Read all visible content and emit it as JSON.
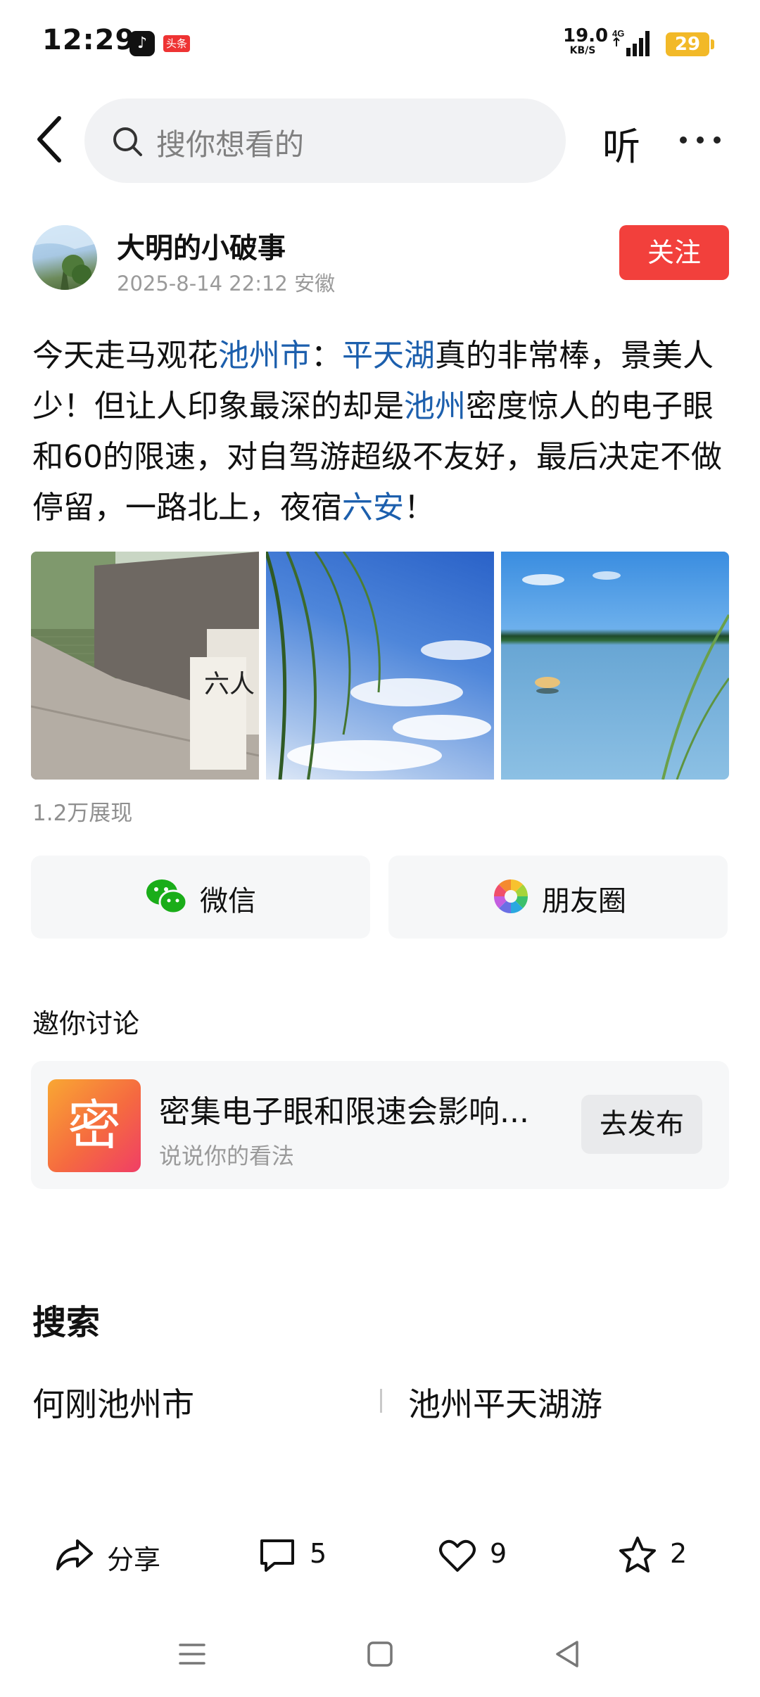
{
  "status_bar": {
    "time": "12:29",
    "app_badge_1": "♪",
    "app_badge_2": "头条",
    "net_speed": "19.0",
    "net_unit": "KB/S",
    "network_type": "4G",
    "battery": "29"
  },
  "nav": {
    "search_placeholder": "搜你想看的",
    "listen_label": "听"
  },
  "author": {
    "name": "大明的小破事",
    "meta": "2025-8-14 22:12 安徽",
    "follow_label": "关注"
  },
  "post": {
    "segments": [
      {
        "text": "今天走马观花",
        "link": false
      },
      {
        "text": "池州市",
        "link": true
      },
      {
        "text": "：",
        "link": false
      },
      {
        "text": "平天湖",
        "link": true
      },
      {
        "text": "真的非常棒，景美人少！但让人印象最深的却是",
        "link": false
      },
      {
        "text": "池州",
        "link": true
      },
      {
        "text": "密度惊人的电子眼和60的限速，对自驾游超级不友好，最后决定不做停留，一路北上，夜宿",
        "link": false
      },
      {
        "text": "六安",
        "link": true
      },
      {
        "text": "！",
        "link": false
      }
    ],
    "image_sign_text": "六人"
  },
  "views": "1.2万展现",
  "share": {
    "wechat_label": "微信",
    "moments_label": "朋友圈"
  },
  "invite": {
    "title": "邀你讨论",
    "badge": "密",
    "topic": "密集电子眼和限速会影响...",
    "subtitle": "说说你的看法",
    "button": "去发布"
  },
  "search_section": {
    "title": "搜索",
    "suggestions": [
      "何刚池州市",
      "池州平天湖游"
    ]
  },
  "actions": {
    "share_label": "分享",
    "comments": "5",
    "likes": "9",
    "favorites": "2"
  },
  "colors": {
    "link": "#1c5fad",
    "follow": "#f2403c",
    "battery": "#f2b928",
    "wechat": "#1aad19"
  }
}
